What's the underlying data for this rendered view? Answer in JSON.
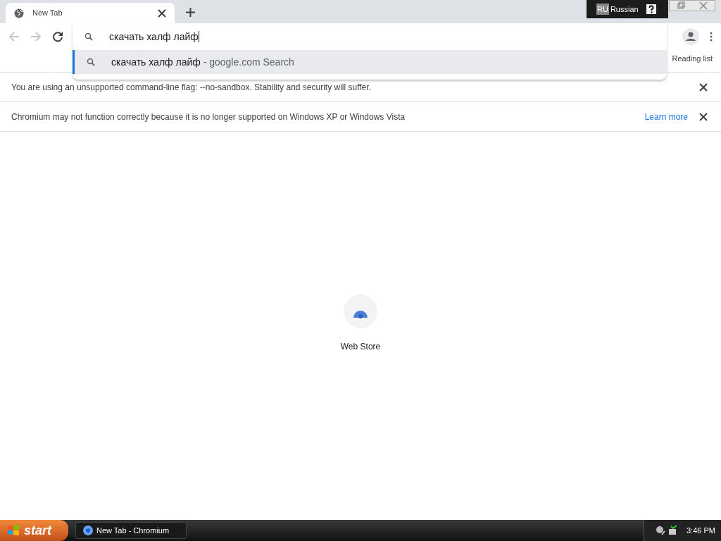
{
  "tab": {
    "title": "New Tab"
  },
  "omnibox": {
    "value": "скачать халф лайф"
  },
  "suggestions": [
    {
      "query": "скачать халф лайф",
      "source": "- google.com Search",
      "selected": true
    }
  ],
  "bookmarks_bar": {
    "reading_list": "Reading list"
  },
  "language_bar": {
    "code": "RU",
    "language": "Russian"
  },
  "infobars": [
    {
      "message": "You are using an unsupported command-line flag: --no-sandbox. Stability and security will suffer."
    },
    {
      "message": "Chromium may not function correctly because it is no longer supported on Windows XP or Windows Vista",
      "link": "Learn more"
    }
  ],
  "shortcuts": [
    {
      "label": "Web Store"
    }
  ],
  "taskbar": {
    "start": "start",
    "tasks": [
      {
        "label": "New Tab - Chromium"
      }
    ],
    "clock": "3:46 PM"
  }
}
